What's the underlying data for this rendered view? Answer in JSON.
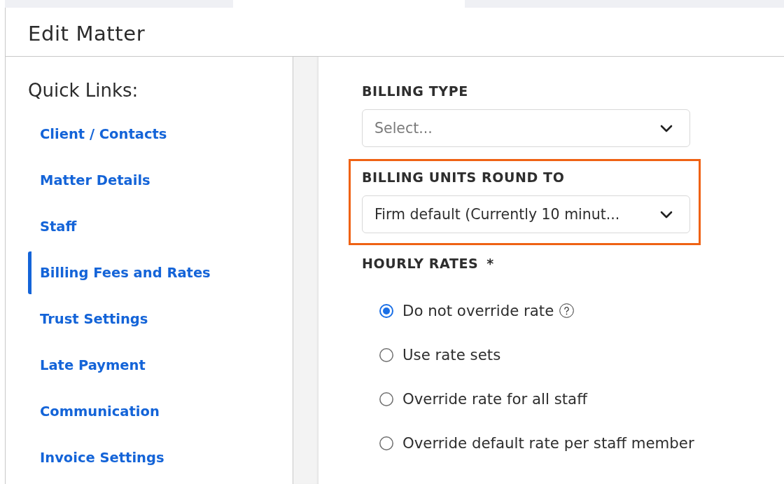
{
  "top_tabs": [
    {
      "selected": false
    },
    {
      "selected": true
    },
    {
      "selected": false
    }
  ],
  "header": {
    "title": "Edit Matter"
  },
  "sidebar": {
    "heading": "Quick Links:",
    "items": [
      {
        "label": "Client / Contacts",
        "selected": false
      },
      {
        "label": "Matter Details",
        "selected": false
      },
      {
        "label": "Staff",
        "selected": false
      },
      {
        "label": "Billing Fees and Rates",
        "selected": true
      },
      {
        "label": "Trust Settings",
        "selected": false
      },
      {
        "label": "Late Payment",
        "selected": false
      },
      {
        "label": "Communication",
        "selected": false
      },
      {
        "label": "Invoice Settings",
        "selected": false
      }
    ]
  },
  "form": {
    "fields": [
      {
        "kind": "select",
        "label": "BILLING TYPE",
        "placeholder": "Select..."
      },
      {
        "kind": "select",
        "label": "BILLING UNITS ROUND TO",
        "value": "Firm default (Currently 10 minut...",
        "highlighted": true
      },
      {
        "kind": "radio-group",
        "label": "HOURLY RATES",
        "required_mark": "*",
        "options": [
          {
            "label": "Do not override rate",
            "selected": true,
            "help": true
          },
          {
            "label": "Use rate sets",
            "selected": false
          },
          {
            "label": "Override rate for all staff",
            "selected": false
          },
          {
            "label": "Override default rate per staff member",
            "selected": false
          }
        ]
      }
    ]
  }
}
